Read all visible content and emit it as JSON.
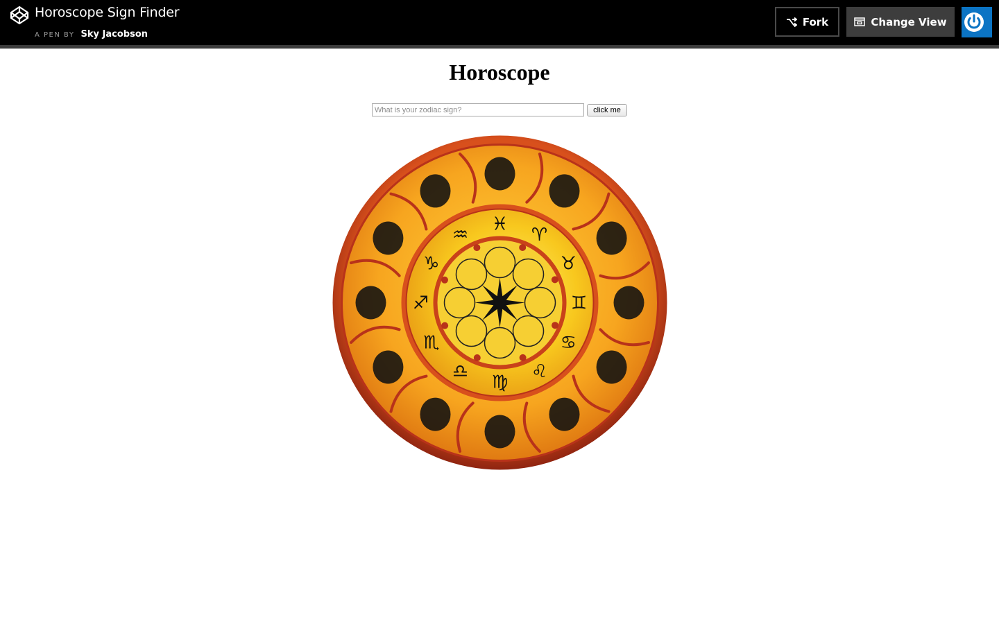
{
  "header": {
    "pen_title": "Horoscope Sign Finder",
    "byline_prefix": "A PEN BY",
    "author": "Sky Jacobson",
    "fork_label": "Fork",
    "change_view_label": "Change View",
    "logo_icon": "codepen-logo-icon",
    "power_icon": "power-icon",
    "accent_color": "#0b74c4"
  },
  "main": {
    "title": "Horoscope",
    "input_placeholder": "What is your zodiac sign?",
    "input_value": "",
    "button_label": "click me"
  },
  "wheel": {
    "colors": {
      "rim": "#b8321a",
      "outer_ring": "#f29a1c",
      "inner_ring": "#f7c219",
      "center": "#f8d63a"
    },
    "zodiac_symbols": [
      "♓",
      "♈",
      "♉",
      "♊",
      "♋",
      "♌",
      "♍",
      "♎",
      "♏",
      "♐",
      "♑",
      "♒"
    ]
  }
}
